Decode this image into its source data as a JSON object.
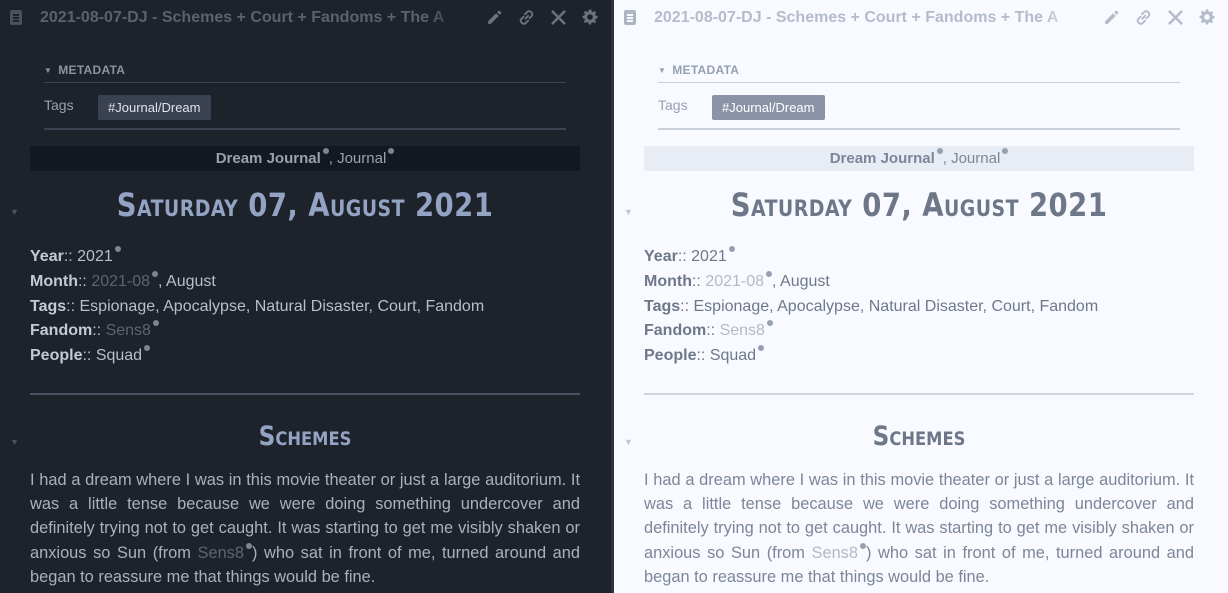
{
  "note": {
    "title": "2021-08-07-DJ - Schemes + Court + Fandoms + The A",
    "metadata_header": "METADATA",
    "tags_label": "Tags",
    "tag_value": "#Journal/Dream",
    "banner_bold": "Dream Journal",
    "banner_sep": ",",
    "banner_rest": "Journal",
    "h1": "Saturday 07, August 2021",
    "props": {
      "year_key": "Year",
      "year_sep": ":: ",
      "year_val": "2021",
      "month_key": "Month",
      "month_sep": ":: ",
      "month_link": "2021-08",
      "month_rest": ", August",
      "tags_key": "Tags",
      "tags_sep": ":: ",
      "tags_val": "Espionage, Apocalypse, Natural Disaster, Court, Fandom",
      "fandom_key": "Fandom",
      "fandom_sep": ":: ",
      "fandom_link": "Sens8",
      "people_key": "People",
      "people_sep": ":: ",
      "people_val": "Squad"
    },
    "h2": "Schemes",
    "para_part1": "I had a dream where I was in this movie theater or just a large auditorium. It was a little tense because we were doing something undercover and definitely trying not to get caught. It was starting to get me visibly shaken or anxious so Sun (from ",
    "para_link": "Sens8",
    "para_part2": ") who sat in front of me, turned around and began to reassure me that things would be fine."
  },
  "colors": {
    "dark_bg": "#1e222a",
    "light_bg": "#f8faff",
    "dark_heading": "#93a3c3",
    "light_heading": "#6e7788"
  },
  "icons": [
    "document-icon",
    "pencil-icon",
    "link-icon",
    "close-icon",
    "gear-icon",
    "fold-triangle-icon"
  ]
}
